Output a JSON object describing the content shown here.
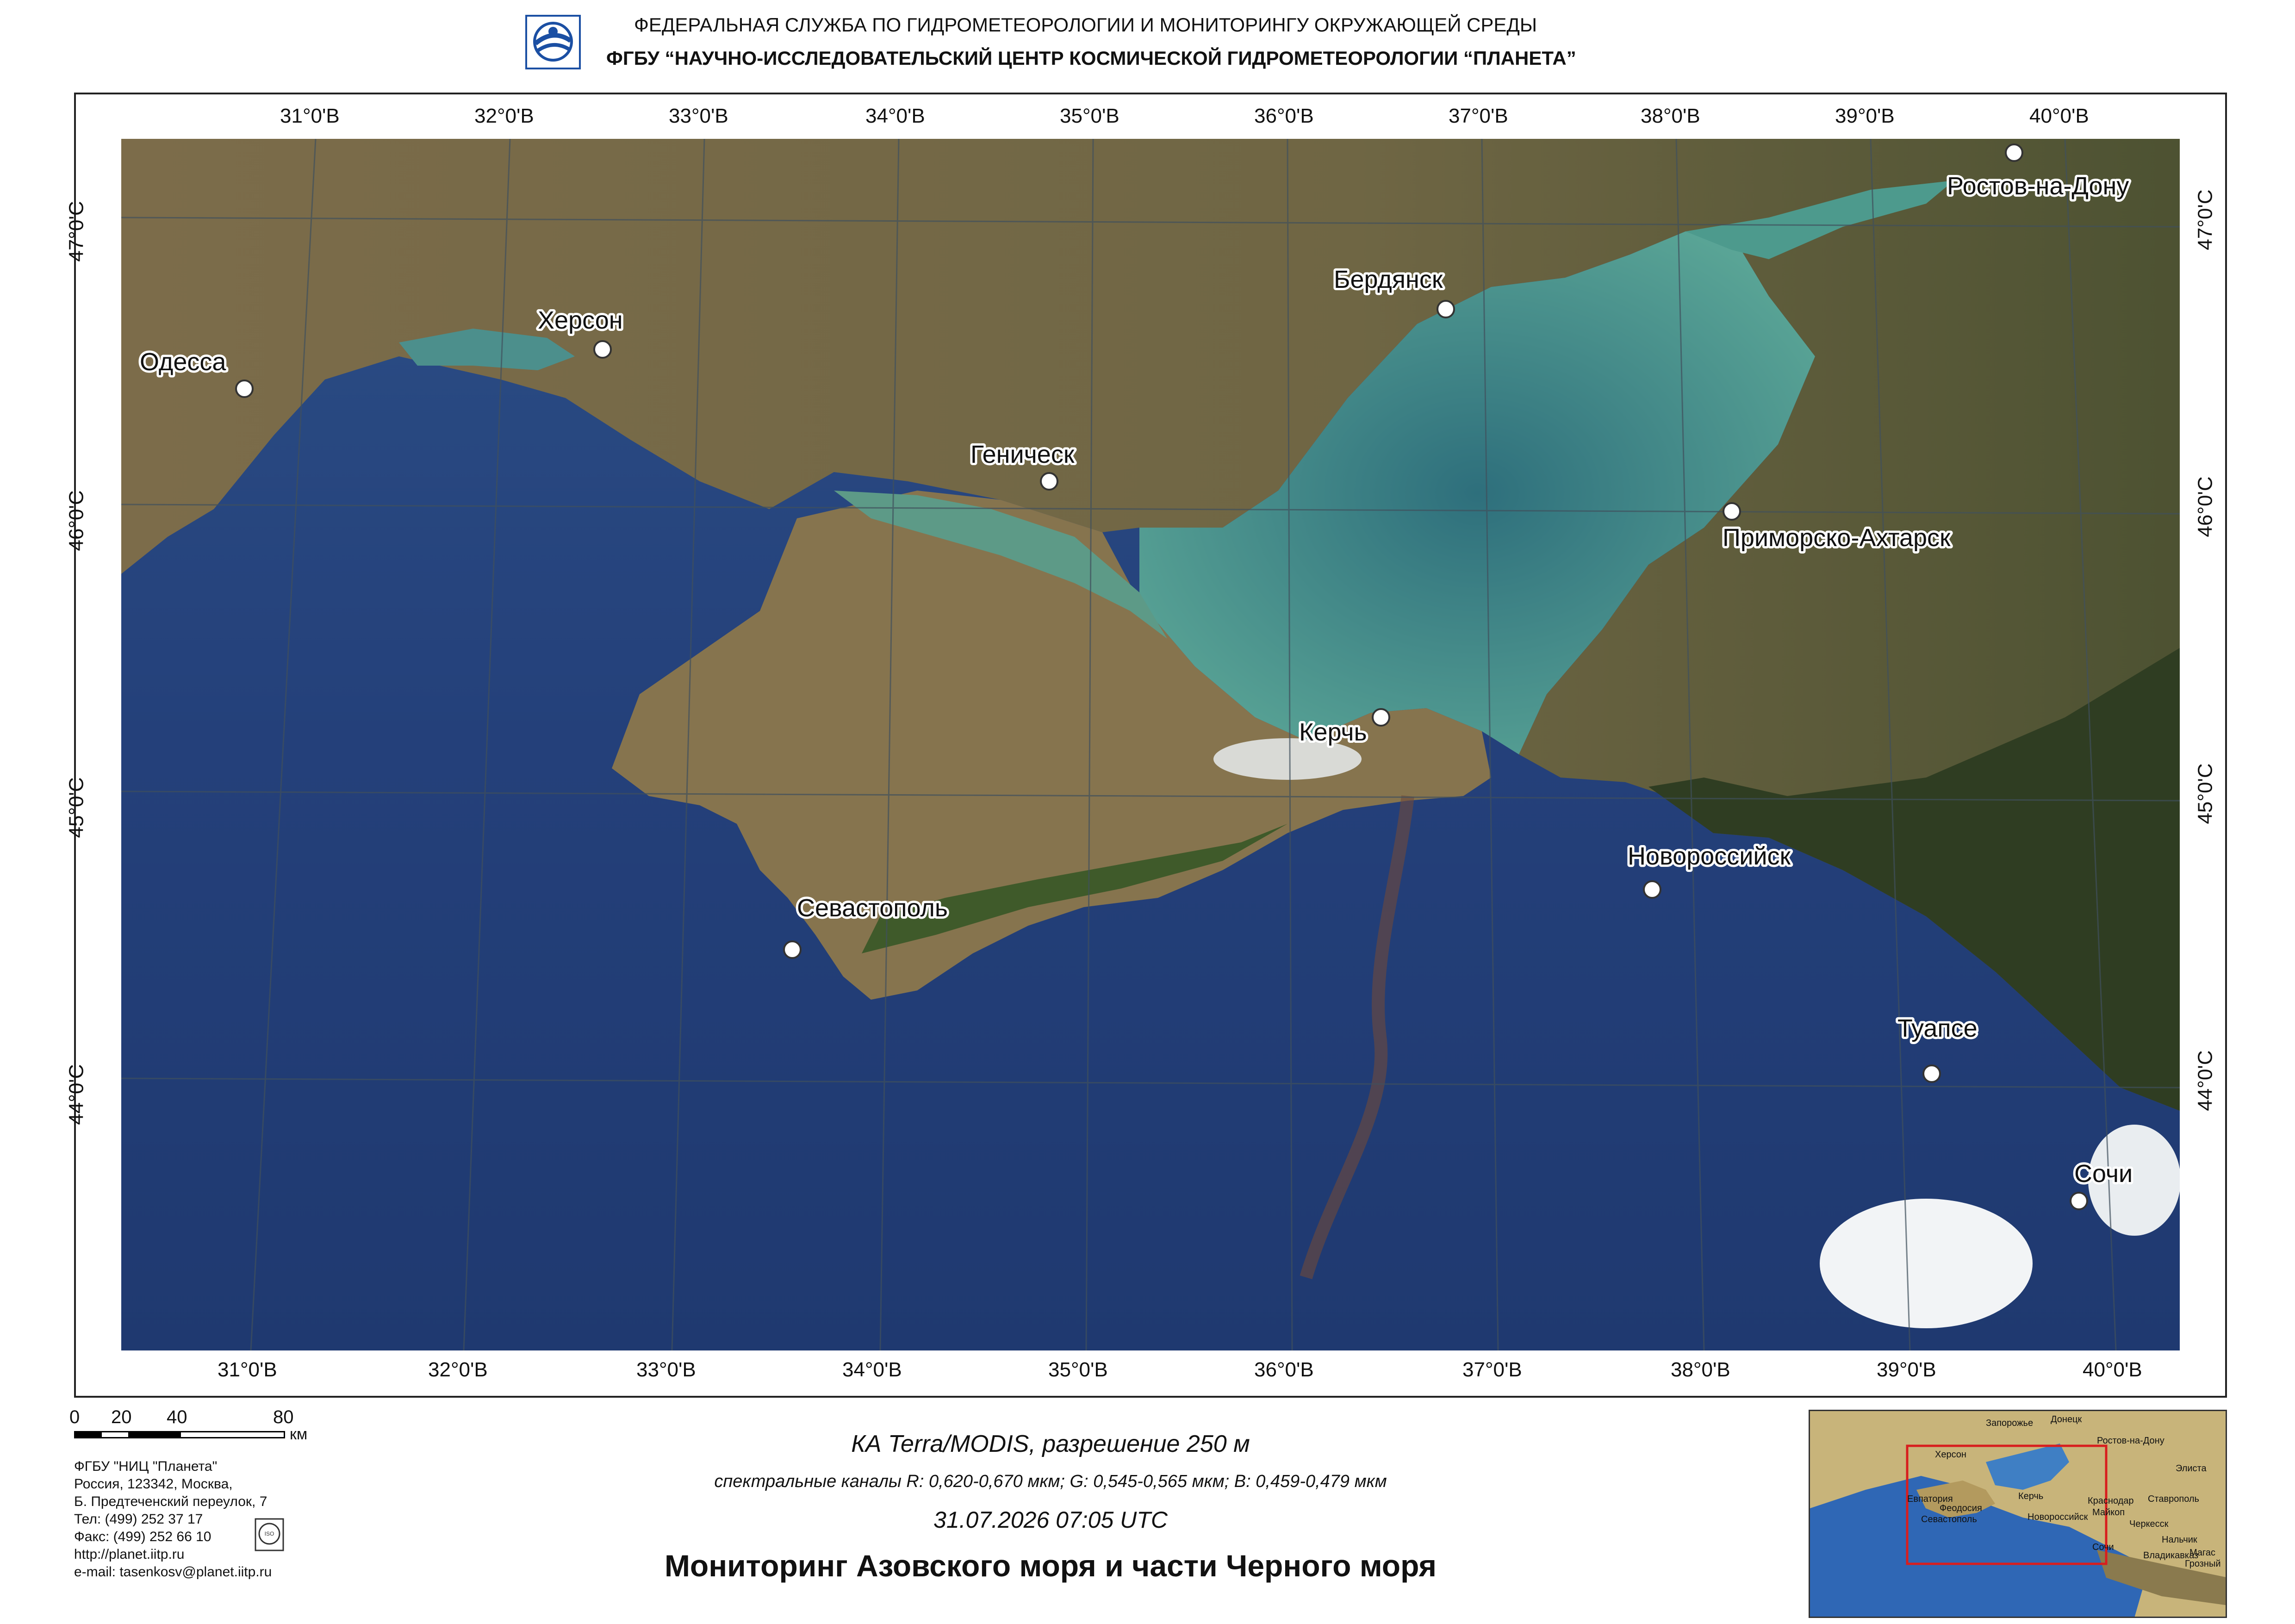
{
  "header": {
    "agency": "ФЕДЕРАЛЬНАЯ  СЛУЖБА  ПО ГИДРОМЕТЕОРОЛОГИИ И МОНИТОРИНГУ ОКРУЖАЮЩЕЙ СРЕДЫ",
    "institute": "ФГБУ “НАУЧНО-ИССЛЕДОВАТЕЛЬСКИЙ ЦЕНТР КОСМИЧЕСКОЙ ГИДРОМЕТЕОРОЛОГИИ “ПЛАНЕТА”"
  },
  "map": {
    "lon_labels": [
      "31°0'В",
      "32°0'В",
      "33°0'В",
      "34°0'В",
      "35°0'В",
      "36°0'В",
      "37°0'В",
      "38°0'В",
      "39°0'В",
      "40°0'В"
    ],
    "lat_labels": [
      "47°0'С",
      "46°0'С",
      "45°0'С",
      "44°0'С"
    ],
    "cities": [
      {
        "name": "Одесса"
      },
      {
        "name": "Херсон"
      },
      {
        "name": "Геническ"
      },
      {
        "name": "Бердянск"
      },
      {
        "name": "Ростов-на-Дону"
      },
      {
        "name": "Приморско-Ахтарск"
      },
      {
        "name": "Керчь"
      },
      {
        "name": "Новороссийск"
      },
      {
        "name": "Севастополь"
      },
      {
        "name": "Туапсе"
      },
      {
        "name": "Сочи"
      }
    ],
    "colors": {
      "sea": "#22417a",
      "azov": "#3f8a86",
      "land": "#7a6a48",
      "frame": "#222222"
    }
  },
  "scale_bar": {
    "ticks": [
      "0",
      "20",
      "40",
      "80"
    ],
    "unit": "км"
  },
  "contacts": {
    "lines": [
      "ФГБУ \"НИЦ \"Планета\"",
      "Россия, 123342,  Москва,",
      "Б. Предтеченский переулок, 7",
      "Тел: (499) 252 37 17",
      "Факс: (499) 252 66 10",
      "http://planet.iitp.ru",
      "e-mail: tasenkosv@planet.iitp.ru"
    ]
  },
  "caption": {
    "satellite": "КА Terra/MODIS, разрешение 250 м",
    "channels": "спектральные каналы R: 0,620-0,670 мкм; G: 0,545-0,565 мкм;  B: 0,459-0,479 мкм",
    "datetime": "31.07.2026   07:05 UTC",
    "title": "Мониторинг Азовского моря и части Черного моря"
  },
  "inset": {
    "labels": [
      "Запорожье",
      "Донецк",
      "Херсон",
      "Ростов-на-Дону",
      "Элиста",
      "Евпатория",
      "Феодосия",
      "Керчь",
      "Краснодар",
      "Ставрополь",
      "Севастополь",
      "Новороссийск",
      "Майкоп",
      "Черкесск",
      "Нальчик",
      "Владикавказ",
      "Сочи",
      "Магас",
      "Грозный"
    ]
  }
}
